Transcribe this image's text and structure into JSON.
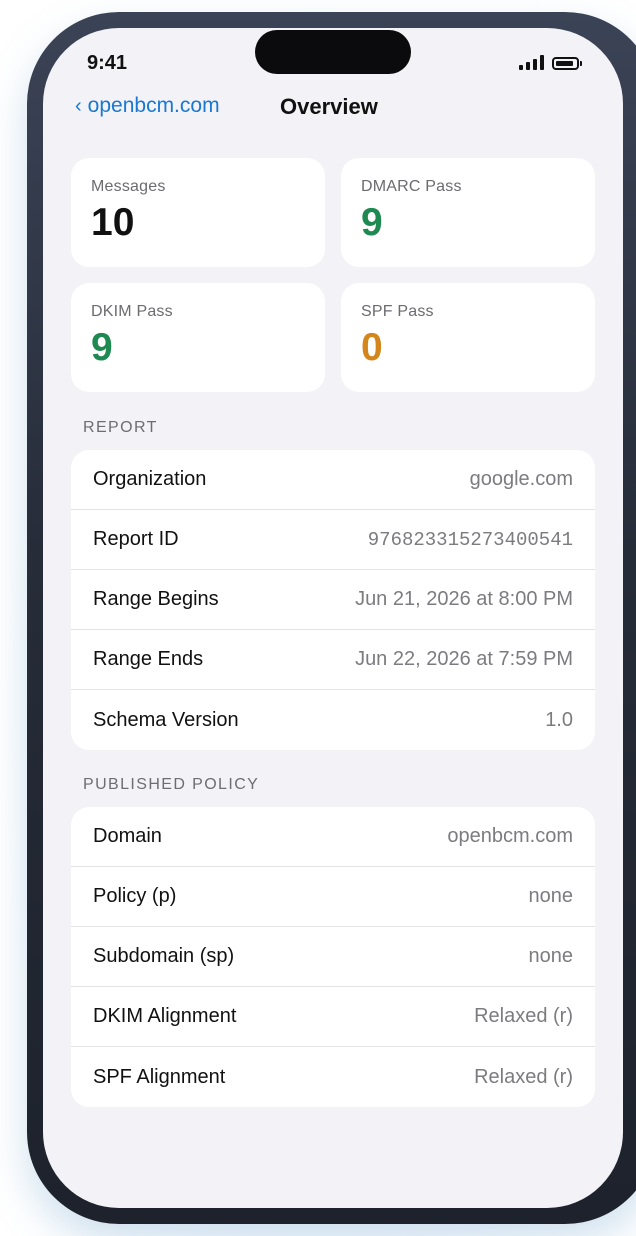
{
  "status_bar": {
    "time": "9:41"
  },
  "nav": {
    "back_label": "openbcm.com",
    "title": "Overview"
  },
  "stats": [
    {
      "label": "Messages",
      "value": "10",
      "color": "#111111"
    },
    {
      "label": "DMARC Pass",
      "value": "9",
      "color": "#1e8a52"
    },
    {
      "label": "DKIM Pass",
      "value": "9",
      "color": "#1e8a52"
    },
    {
      "label": "SPF Pass",
      "value": "0",
      "color": "#d4861c"
    }
  ],
  "report": {
    "header": "REPORT",
    "rows": [
      {
        "label": "Organization",
        "value": "google.com"
      },
      {
        "label": "Report ID",
        "value": "976823315273400541"
      },
      {
        "label": "Range Begins",
        "value": "Jun 21, 2026 at 8:00 PM"
      },
      {
        "label": "Range Ends",
        "value": "Jun 22, 2026 at 7:59 PM"
      },
      {
        "label": "Schema Version",
        "value": "1.0"
      }
    ]
  },
  "policy": {
    "header": "PUBLISHED POLICY",
    "rows": [
      {
        "label": "Domain",
        "value": "openbcm.com"
      },
      {
        "label": "Policy (p)",
        "value": "none"
      },
      {
        "label": "Subdomain (sp)",
        "value": "none"
      },
      {
        "label": "DKIM Alignment",
        "value": "Relaxed (r)"
      },
      {
        "label": "SPF Alignment",
        "value": "Relaxed (r)"
      }
    ]
  },
  "colors": {
    "accent": "#1a78d0",
    "pass_green": "#1e8a52",
    "fail_orange": "#d4861c"
  },
  "icons": [
    "chevron-left-icon",
    "cellular-signal-icon",
    "battery-icon"
  ]
}
